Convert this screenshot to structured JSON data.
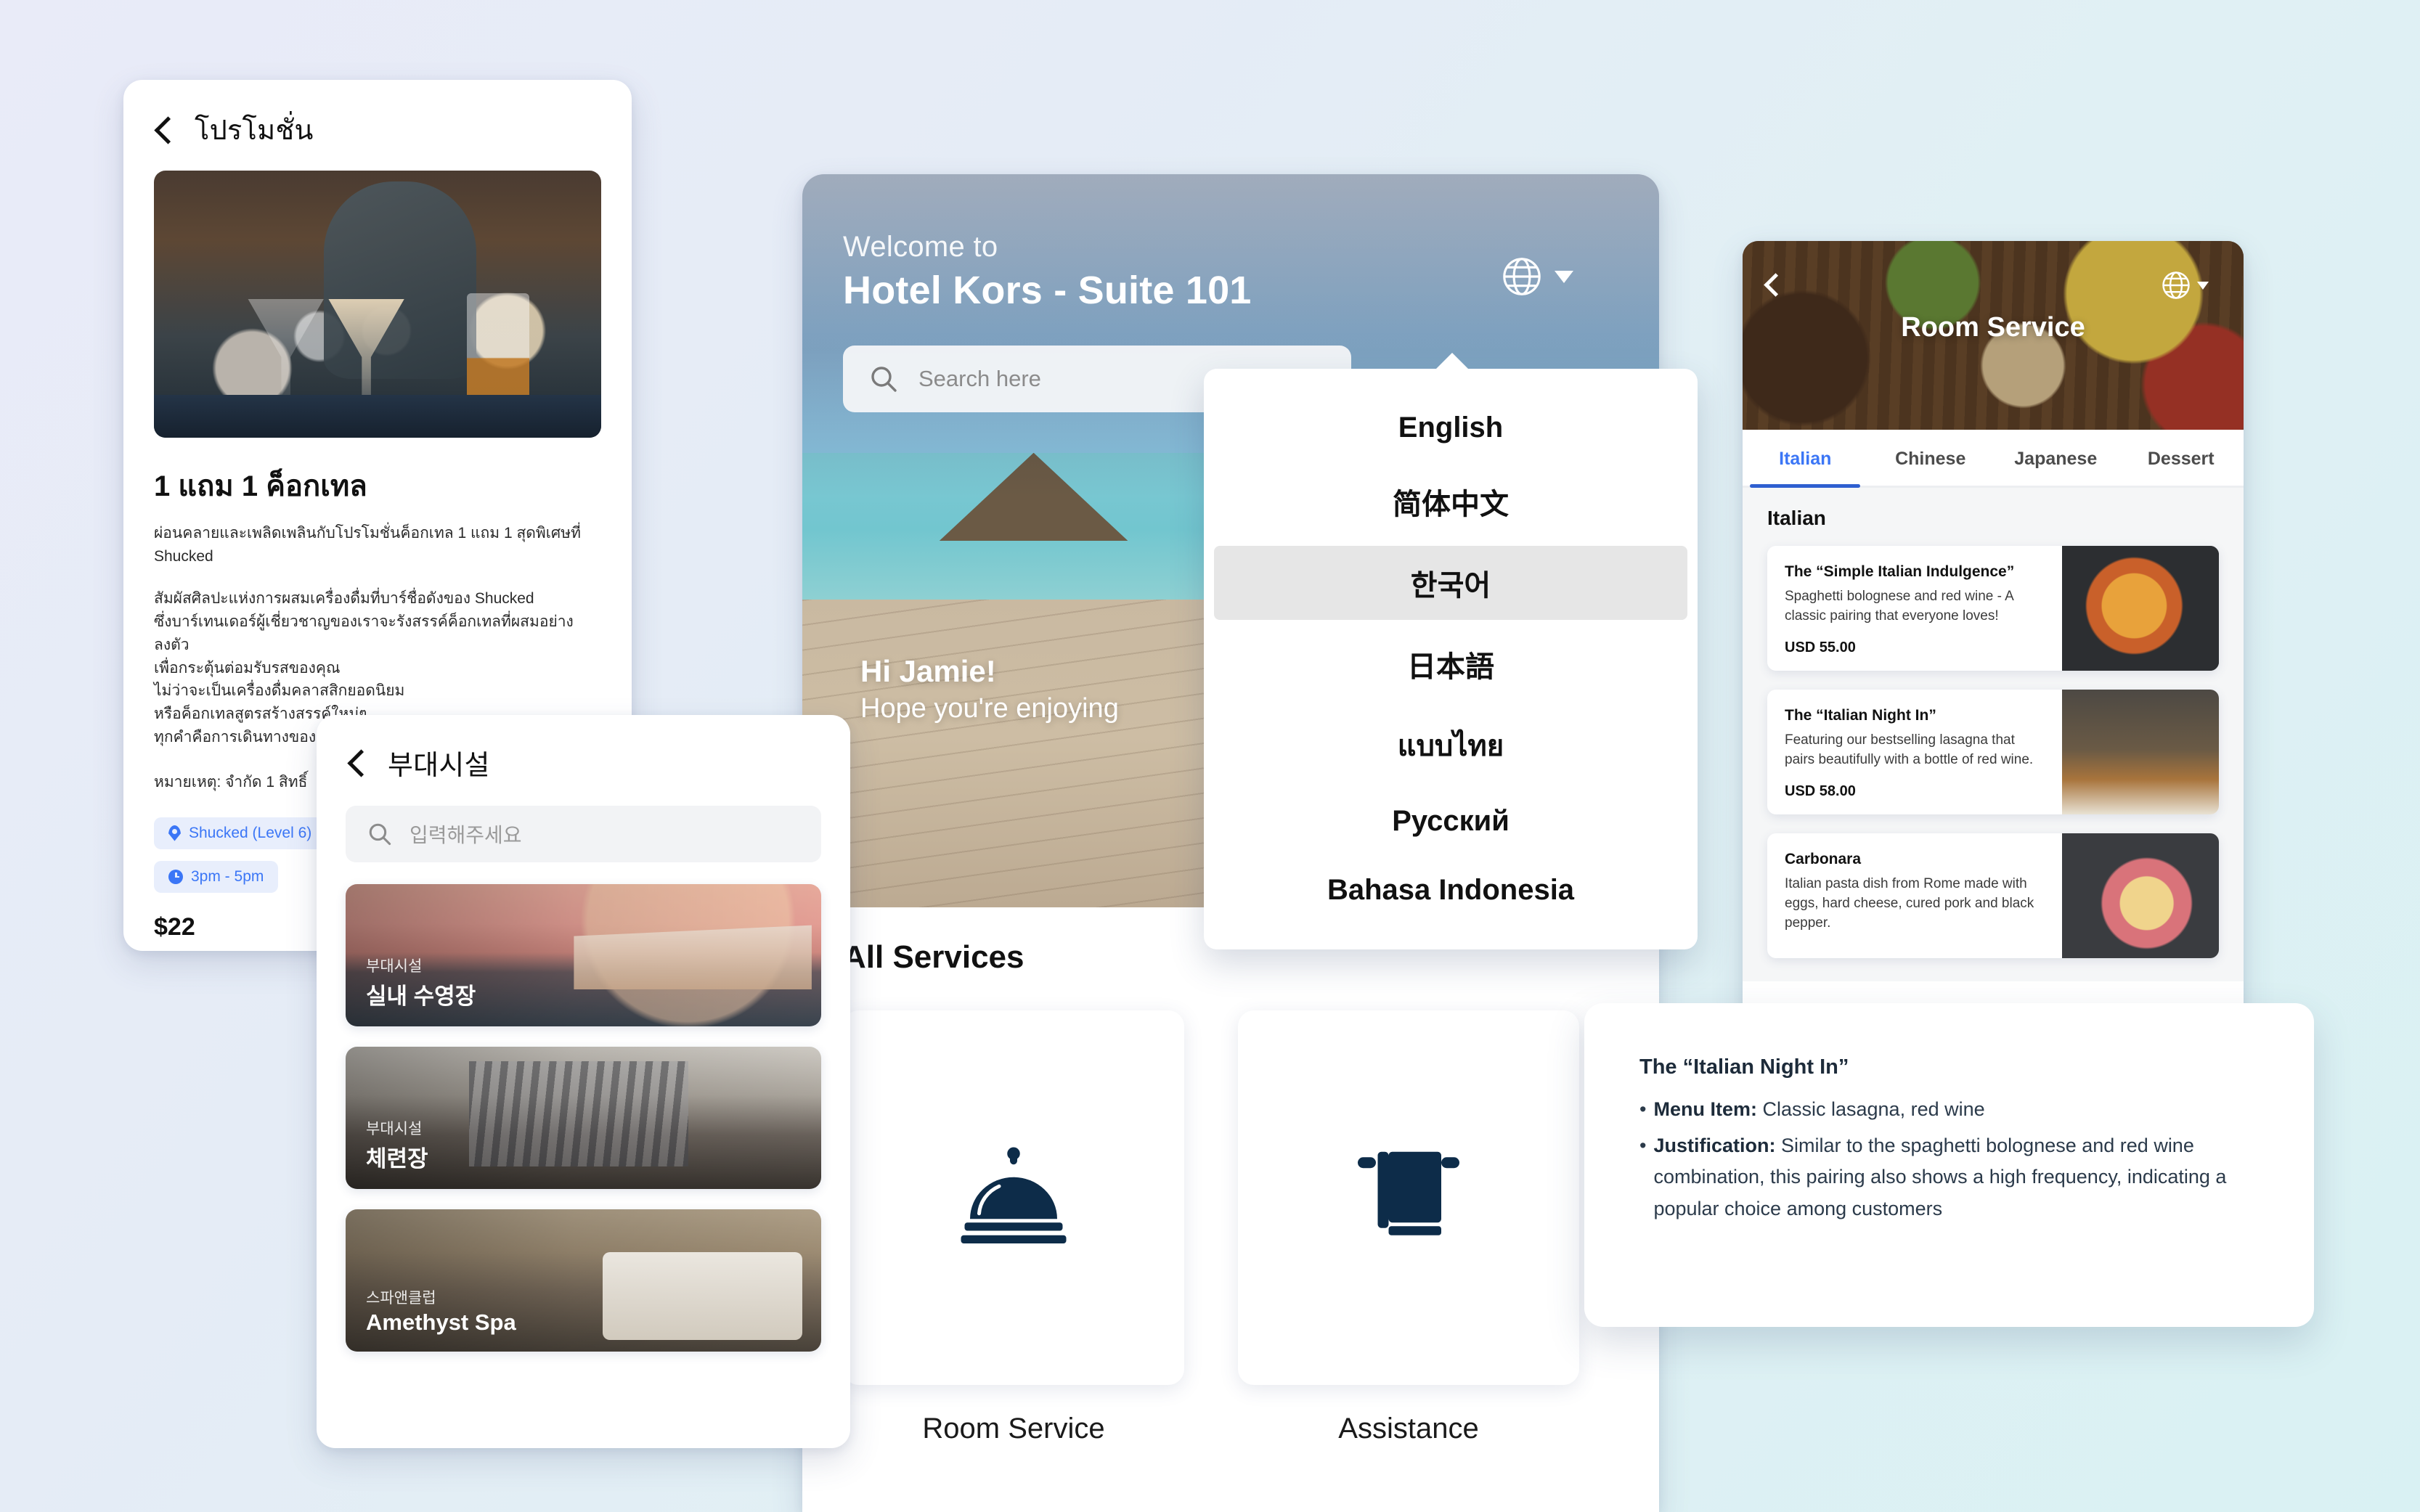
{
  "background": {
    "from": "#e9ebf8",
    "to": "#d9f1f3"
  },
  "accent_blue": "#3b76f6",
  "promo_panel": {
    "title": "โปรโมชั่น",
    "back_icon": "chevron-left-icon",
    "hero_alt": "bartender-pouring-cocktail",
    "heading": "1 แถม 1 ค็อกเทล",
    "subtitle": "ผ่อนคลายและเพลิดเพลินกับโปรโมชั่นค็อกเทล 1 แถม 1\nสุดพิเศษที่ Shucked",
    "description": "สัมผัสศิลปะแห่งการผสมเครื่องดื่มที่บาร์ชื่อดังของ Shucked\nซึ่งบาร์เทนเดอร์ผู้เชี่ยวชาญของเราจะรังสรรค์ค็อกเทลที่ผสมอย่างลงตัว\nเพื่อกระตุ้นต่อมรับรสของคุณ\nไม่ว่าจะเป็นเครื่องดื่มคลาสสิกยอดนิยม\nหรือค็อกเทลสูตรสร้างสรรค์ใหม่ๆ\nทุกคำคือการเดินทางของรสชาติและความประณีต",
    "note": "หมายเหตุ: จำกัด 1 สิทธิ์",
    "next_icon": "chevron-right-circle-icon",
    "chips": [
      {
        "icon": "location-pin-icon",
        "label": "Shucked (Level 6)"
      },
      {
        "icon": "clock-icon",
        "label": "3pm - 5pm"
      }
    ],
    "price": "$22",
    "cta_label": ""
  },
  "main_panel": {
    "welcome_small": "Welcome to",
    "welcome_big": "Hotel Kors - Suite 101",
    "language_icon": "globe-icon",
    "language_caret_icon": "caret-down-icon",
    "search": {
      "icon": "search-icon",
      "placeholder": "Search here",
      "value": ""
    },
    "greeting_name": "Hi Jamie!",
    "greeting_line": "Hope you're enjoying",
    "services_title": "All Services",
    "services": [
      {
        "icon": "service-bell-icon",
        "label": "Room Service"
      },
      {
        "icon": "towel-icon",
        "label": "Assistance"
      }
    ]
  },
  "language_menu": {
    "selected": "한국어",
    "items": [
      "English",
      "简体中文",
      "한국어",
      "日本語",
      "แบบไทย",
      "Русский",
      "Bahasa Indonesia"
    ]
  },
  "facilities_panel": {
    "back_icon": "chevron-left-icon",
    "title": "부대시설",
    "search": {
      "icon": "search-icon",
      "placeholder": "입력해주세요",
      "value": ""
    },
    "cards": [
      {
        "kicker": "부대시설",
        "name": "실내 수영장",
        "image": "outdoor-pool-sunset"
      },
      {
        "kicker": "부대시설",
        "name": "체련장",
        "image": "fitness-gym"
      },
      {
        "kicker": "스파앤클럽",
        "name": "Amethyst Spa",
        "image": "spa-treatment-room"
      }
    ]
  },
  "roomservice_panel": {
    "back_icon": "chevron-left-icon",
    "language_icon": "globe-icon",
    "language_caret_icon": "caret-down-icon",
    "hero_title": "Room Service",
    "tabs": [
      {
        "label": "Italian",
        "active": true
      },
      {
        "label": "Chinese",
        "active": false
      },
      {
        "label": "Japanese",
        "active": false
      },
      {
        "label": "Dessert",
        "active": false
      }
    ],
    "section_title": "Italian",
    "items": [
      {
        "name": "The “Simple Italian Indulgence”",
        "description": "Spaghetti bolognese and red wine - A classic pairing that everyone loves!",
        "price": "USD 55.00",
        "image": "spaghetti-bolognese"
      },
      {
        "name": "The “Italian Night In”",
        "description": "Featuring our bestselling lasagna that pairs beautifully with a bottle of red wine.",
        "price": "USD 58.00",
        "image": "lasagna-red-wine"
      },
      {
        "name": "Carbonara",
        "description": "Italian pasta dish from Rome made with eggs, hard cheese, cured pork and black pepper.",
        "price": "",
        "image": "carbonara-pasta"
      }
    ]
  },
  "explain_card": {
    "title": "The “Italian Night In”",
    "bullets": [
      {
        "bullet": "•",
        "label": "Menu Item:",
        "text": "Classic lasagna, red wine"
      },
      {
        "bullet": "•",
        "label": "Justification:",
        "text": "Similar to the spaghetti bolognese and red wine combination, this pairing also shows a high frequency, indicating a popular choice among customers"
      }
    ]
  }
}
